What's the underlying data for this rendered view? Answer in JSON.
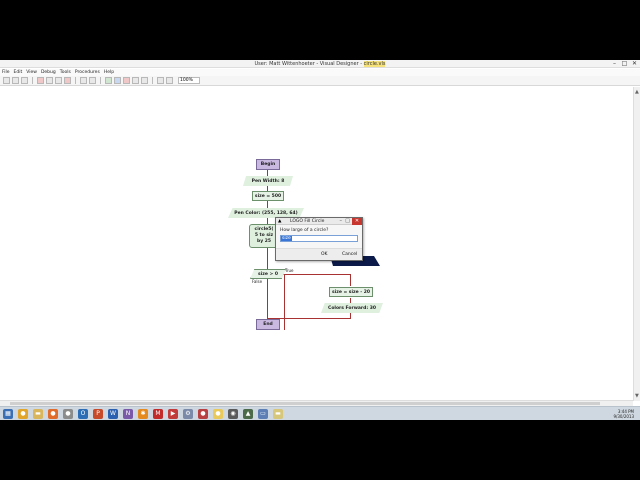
{
  "window": {
    "title_prefix": "User: Matt Wittenhoeter - Visual Designer - ",
    "title_file": "circle.vls",
    "controls": [
      "–",
      "□",
      "✕"
    ]
  },
  "menu": [
    "File",
    "Edit",
    "View",
    "Debug",
    "Tools",
    "Procedures",
    "Help"
  ],
  "toolbar": {
    "zoom": "100%"
  },
  "flowchart": {
    "begin": "Begin",
    "pen_width": "Pen Width: 8",
    "size_set": "size = 500",
    "pen_color": "Pen Color: (255, 128, 64)",
    "circle_call_line1": "circle5(",
    "circle_call_line2": "5 to siz",
    "circle_call_line3": "by 25",
    "condition": "size > 0",
    "true_label": "True",
    "false_label": "False",
    "size_update": "size = size - 20",
    "colors_forward": "Colors Forward: 30",
    "end": "End"
  },
  "dialog": {
    "title": "LOGO Fill Circle",
    "prompt": "How large of a circle?",
    "value": "size",
    "ok": "OK",
    "cancel": "Cancel"
  },
  "taskbar": {
    "time": "3:44 PM",
    "date": "9/30/2013"
  }
}
